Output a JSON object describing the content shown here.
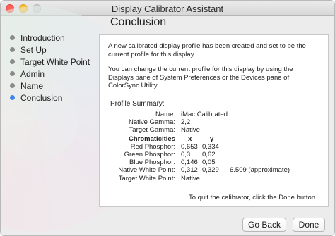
{
  "window": {
    "title": "Display Calibrator Assistant"
  },
  "steps": [
    {
      "label": "Introduction",
      "active": false
    },
    {
      "label": "Set Up",
      "active": false
    },
    {
      "label": "Target White Point",
      "active": false
    },
    {
      "label": "Admin",
      "active": false
    },
    {
      "label": "Name",
      "active": false
    },
    {
      "label": "Conclusion",
      "active": true
    }
  ],
  "content": {
    "heading": "Conclusion",
    "para1": "A new calibrated display profile has been created and set to be the current profile for this display.",
    "para2": "You can change the current profile for this display by using the Displays pane of System Preferences or the Devices pane of ColorSync Utility.",
    "summary_title": "Profile Summary:",
    "name_label": "Name:",
    "name_value": "iMac Calibrated",
    "native_gamma_label": "Native Gamma:",
    "native_gamma_value": "2,2",
    "target_gamma_label": "Target Gamma:",
    "target_gamma_value": "Native",
    "chromaticities_label": "Chromaticities",
    "col_x": "x",
    "col_y": "y",
    "red_label": "Red Phosphor:",
    "red_x": "0,653",
    "red_y": "0,334",
    "green_label": "Green Phosphor:",
    "green_x": "0,3",
    "green_y": "0,62",
    "blue_label": "Blue Phosphor:",
    "blue_x": "0,146",
    "blue_y": "0,05",
    "native_wp_label": "Native White Point:",
    "native_wp_x": "0,312",
    "native_wp_y": "0,329",
    "native_wp_temp": "6.509 (approximate)",
    "target_wp_label": "Target White Point:",
    "target_wp_value": "Native",
    "quit_text": "To quit the calibrator, click the Done button."
  },
  "buttons": {
    "go_back": "Go Back",
    "done": "Done"
  },
  "colors": {
    "active_step": "#3f86e8",
    "inactive_step": "#8a8a8a"
  }
}
